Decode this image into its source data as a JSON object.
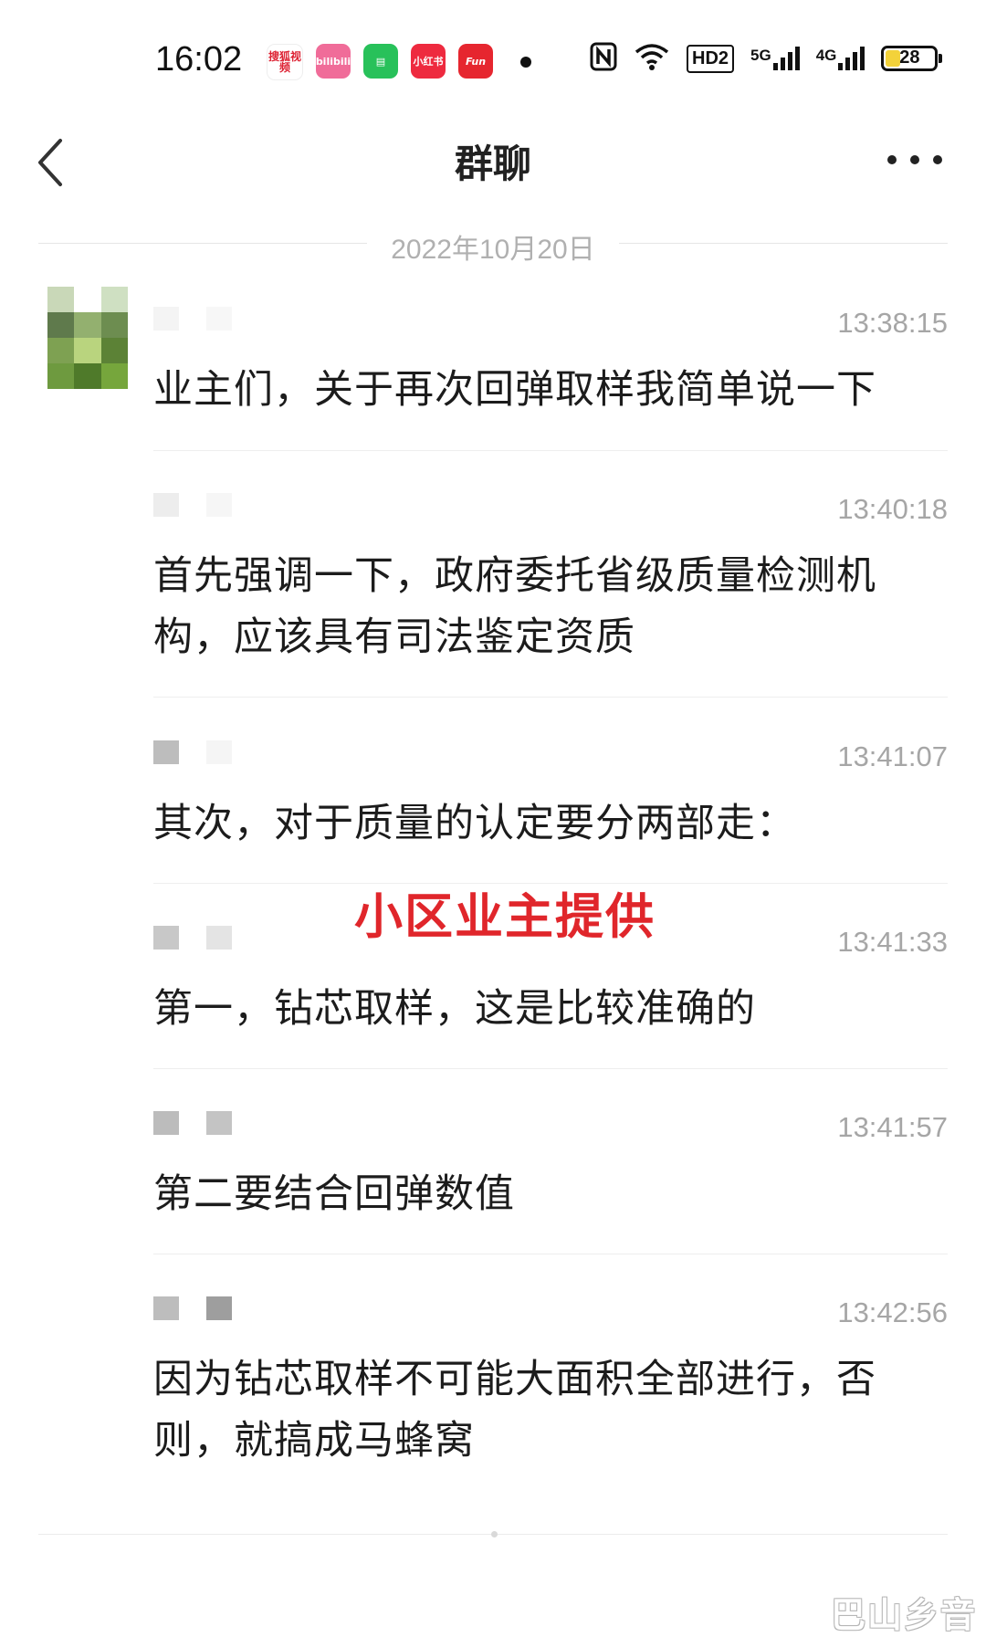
{
  "status_bar": {
    "time": "16:02",
    "apps": [
      {
        "name": "sohu-video-icon",
        "label": "搜狐视频"
      },
      {
        "name": "bilibili-icon",
        "label": "bilibili"
      },
      {
        "name": "chat-app-icon",
        "label": "▤"
      },
      {
        "name": "xiaohongshu-icon",
        "label": "小红书"
      },
      {
        "name": "fun-app-icon",
        "label": "Fun"
      }
    ],
    "hd_label": "HD2",
    "sim1_label": "5G",
    "sim2_label": "4G",
    "battery_level": "28",
    "battery_fill_fraction": 0.28
  },
  "nav": {
    "title": "群聊"
  },
  "date_divider": "2022年10月20日",
  "messages": [
    {
      "time": "13:38:15",
      "text": "业主们，关于再次回弹取样我简单说一下"
    },
    {
      "time": "13:40:18",
      "text": "首先强调一下，政府委托省级质量检测机构，应该具有司法鉴定资质"
    },
    {
      "time": "13:41:07",
      "text": "其次，对于质量的认定要分两部走："
    },
    {
      "time": "13:41:33",
      "text": "第一，钻芯取样，这是比较准确的"
    },
    {
      "time": "13:41:57",
      "text": "第二要结合回弹数值"
    },
    {
      "time": "13:42:56",
      "text": "因为钻芯取样不可能大面积全部进行，否则，就搞成马蜂窝"
    }
  ],
  "overlay_caption": "小区业主提供",
  "corner_watermark": "巴山乡音",
  "colors": {
    "caption_red": "#e0262b",
    "time_gray": "#a6a6a6",
    "battery_yellow": "#f3d23a"
  }
}
